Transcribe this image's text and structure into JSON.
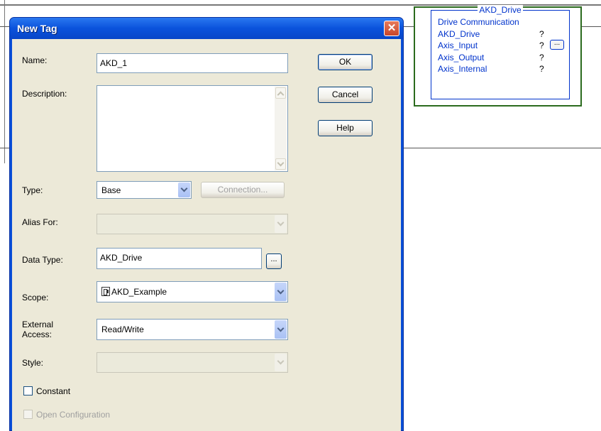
{
  "dialog": {
    "title": "New Tag",
    "close_symbol": "✕"
  },
  "fields": {
    "name_label": "Name:",
    "name_value": "AKD_1",
    "description_label": "Description:",
    "description_value": "",
    "type_label": "Type:",
    "type_value": "Base",
    "connection_button": "Connection...",
    "alias_label": "Alias For:",
    "alias_value": "",
    "data_type_label": "Data Type:",
    "data_type_value": "AKD_Drive",
    "browse_label": "...",
    "scope_label": "Scope:",
    "scope_value": "AKD_Example",
    "external_access_label_1": "External",
    "external_access_label_2": "Access:",
    "external_access_value": "Read/Write",
    "style_label": "Style:",
    "style_value": "",
    "constant_label": "Constant",
    "constant_checked": false,
    "open_config_label": "Open Configuration",
    "open_config_checked": false
  },
  "buttons": {
    "ok": "OK",
    "cancel": "Cancel",
    "help": "Help"
  },
  "aoi_block": {
    "title": "AKD_Drive",
    "rows": [
      "Drive Communication",
      "AKD_Drive",
      "Axis_Input",
      "Axis_Output",
      "Axis_Internal"
    ],
    "values": [
      "?",
      "?",
      "?",
      "?"
    ],
    "browse_label": "...",
    "border_color": "#2b6b1e",
    "text_color": "#0033cc"
  },
  "colors": {
    "titlebar": "#0a52dc",
    "dialog_bg": "#ece9d8"
  }
}
